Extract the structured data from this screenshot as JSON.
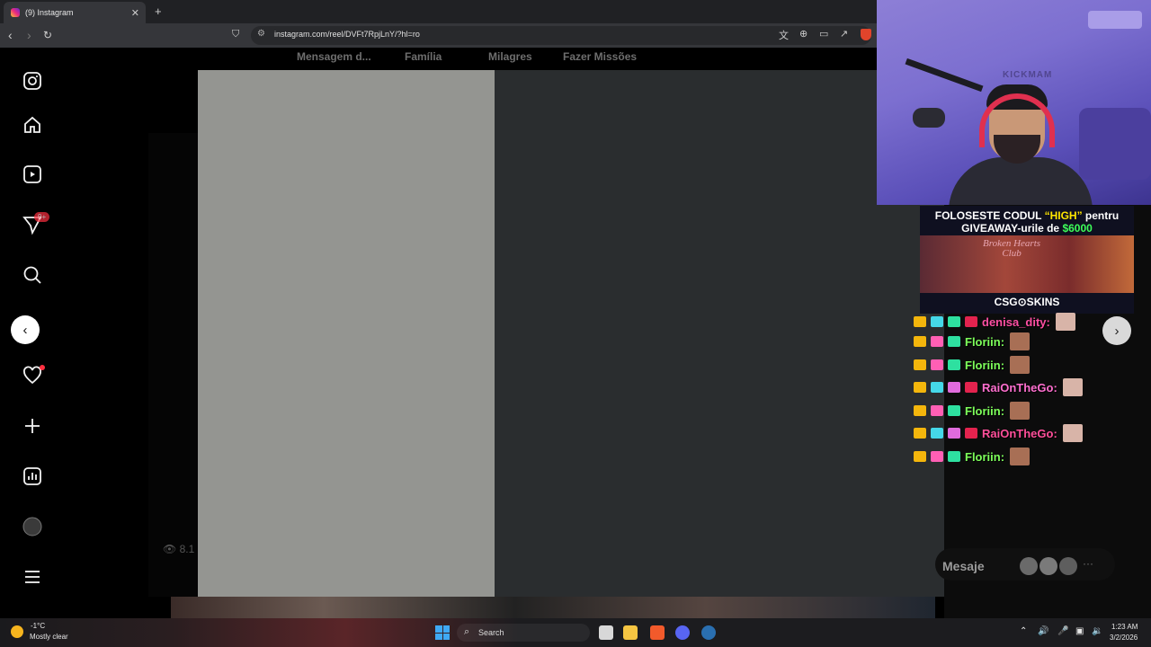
{
  "browser": {
    "tab_title": "(9) Instagram",
    "tab_close": "✕",
    "new_tab": "+",
    "url": "instagram.com/reel/DVFt7RpjLnY/?hl=ro"
  },
  "stories": {
    "labels": [
      "Mensagem d...",
      "Família",
      "Milagres",
      "Fazer Missões"
    ]
  },
  "sidebar": {
    "icons": [
      "instagram-logo-icon",
      "home-icon",
      "reels-icon",
      "messages-icon",
      "search-icon",
      "explore-icon",
      "notifications-icon",
      "create-icon",
      "dashboard-icon",
      "profile-avatar-icon",
      "more-menu-icon"
    ],
    "messages_badge": "9+"
  },
  "reel": {
    "views": "8.1"
  },
  "nav": {
    "prev": "‹",
    "next": "›"
  },
  "promo": {
    "line1_prefix": "FOLOSESTE CODUL ",
    "code": "“HIGH”",
    "line1_suffix": " pentru",
    "line2_prefix": "GIVEAWAY-urile de ",
    "amount": "$6000",
    "club_line1": "Broken Hearts",
    "club_line2": "Club",
    "brand": "CSG⊙SKINS"
  },
  "webcam": {
    "wall_sign": "KICKMAM"
  },
  "chat": {
    "messages": [
      {
        "name": "denisa_dity:",
        "color": "#ff4fa3"
      },
      {
        "name": "Floriin:",
        "color": "#7dff5a"
      },
      {
        "name": "Floriin:",
        "color": "#7dff5a"
      },
      {
        "name": "RaiOnTheGo:",
        "color": "#ff6fcf"
      },
      {
        "name": "Floriin:",
        "color": "#7dff5a"
      },
      {
        "name": "RaiOnTheGo:",
        "color": "#ff4f9a"
      },
      {
        "name": "Floriin:",
        "color": "#7dff5a"
      }
    ],
    "input_label": "Mesaje",
    "more": "···"
  },
  "taskbar": {
    "temperature": "-1°C",
    "weather": "Mostly clear",
    "search": "Search",
    "time": "1:23 AM",
    "date": "3/2/2026"
  }
}
